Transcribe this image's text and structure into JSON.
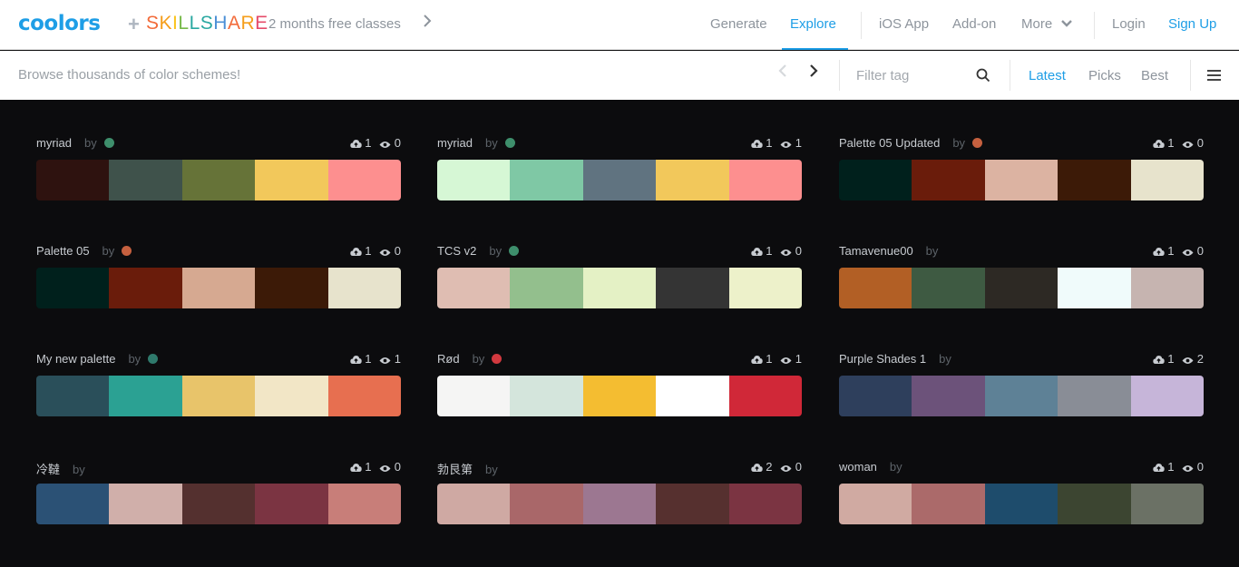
{
  "nav": {
    "logo": "coolors",
    "plus": "+",
    "partner": "SKILLSHARE",
    "partner_colors": [
      "#f26b3a",
      "#f59e1b",
      "#f9c21a",
      "#77b94a",
      "#2aa8a1",
      "#2aa8a1",
      "#4b8fd6",
      "#f26b3a",
      "#f59e1b",
      "#e54b6a"
    ],
    "promo": "2 months free classes",
    "links": [
      "Generate",
      "Explore",
      "iOS App",
      "Add-on",
      "More",
      "Login",
      "Sign Up"
    ]
  },
  "subbar": {
    "browse": "Browse thousands of color schemes!",
    "filter_placeholder": "Filter tag",
    "sorts": [
      "Latest",
      "Picks",
      "Best"
    ]
  },
  "palettes": [
    {
      "name": "myriad",
      "by": "by",
      "avatar": "#3e8f6c",
      "likes": "1",
      "views": "0",
      "colors": [
        "#2e120f",
        "#3f524b",
        "#667338",
        "#f2c85b",
        "#fd8f8f"
      ]
    },
    {
      "name": "myriad",
      "by": "by",
      "avatar": "#3e8f6c",
      "likes": "1",
      "views": "1",
      "colors": [
        "#d6f7d5",
        "#7fc8a5",
        "#607380",
        "#f2c85b",
        "#fd8f8f"
      ]
    },
    {
      "name": "Palette 05 Updated",
      "by": "by",
      "avatar": "#c5603f",
      "likes": "1",
      "views": "0",
      "colors": [
        "#00201c",
        "#6a1c0b",
        "#dcb3a2",
        "#3c1a07",
        "#e7e3cc"
      ]
    },
    {
      "name": "Palette 05",
      "by": "by",
      "avatar": "#c5603f",
      "likes": "1",
      "views": "0",
      "colors": [
        "#00201c",
        "#6a1c0b",
        "#d6a991",
        "#3c1a07",
        "#e7e3cc"
      ]
    },
    {
      "name": "TCS v2",
      "by": "by",
      "avatar": "#3e8f6c",
      "likes": "1",
      "views": "0",
      "colors": [
        "#dfbdb2",
        "#93bf8d",
        "#e4f1c5",
        "#343434",
        "#edf1ca"
      ]
    },
    {
      "name": "Tamavenue00",
      "by": "by",
      "avatar": "",
      "likes": "1",
      "views": "0",
      "colors": [
        "#b25f25",
        "#3e5a42",
        "#2d2924",
        "#f0fbfb",
        "#c6b4b0"
      ]
    },
    {
      "name": "My new palette",
      "by": "by",
      "avatar": "#2f7a6c",
      "likes": "1",
      "views": "1",
      "colors": [
        "#2a4f5a",
        "#2ba193",
        "#e8c46a",
        "#f2e6c6",
        "#e76f50"
      ]
    },
    {
      "name": "Rød",
      "by": "by",
      "avatar": "#d2393f",
      "likes": "1",
      "views": "1",
      "colors": [
        "#f5f5f4",
        "#d4e5dc",
        "#f4bd31",
        "#ffffff",
        "#d02838"
      ]
    },
    {
      "name": "Purple Shades 1",
      "by": "by",
      "avatar": "",
      "likes": "1",
      "views": "2",
      "colors": [
        "#2e3f5c",
        "#6c527a",
        "#5e8196",
        "#898d96",
        "#c6b5d9"
      ]
    },
    {
      "name": "冷韃",
      "by": "by",
      "avatar": "",
      "likes": "1",
      "views": "0",
      "colors": [
        "#2b5175",
        "#d0afaa",
        "#54302f",
        "#7b3442",
        "#c87e79"
      ]
    },
    {
      "name": "勃艮第",
      "by": "by",
      "avatar": "",
      "likes": "2",
      "views": "0",
      "colors": [
        "#cfa9a3",
        "#a96769",
        "#9c7791",
        "#56302f",
        "#7b3442"
      ]
    },
    {
      "name": "woman",
      "by": "by",
      "avatar": "",
      "likes": "1",
      "views": "0",
      "colors": [
        "#d0aaa2",
        "#ab6a6a",
        "#1e4c6c",
        "#3c4531",
        "#6b7165"
      ]
    }
  ]
}
